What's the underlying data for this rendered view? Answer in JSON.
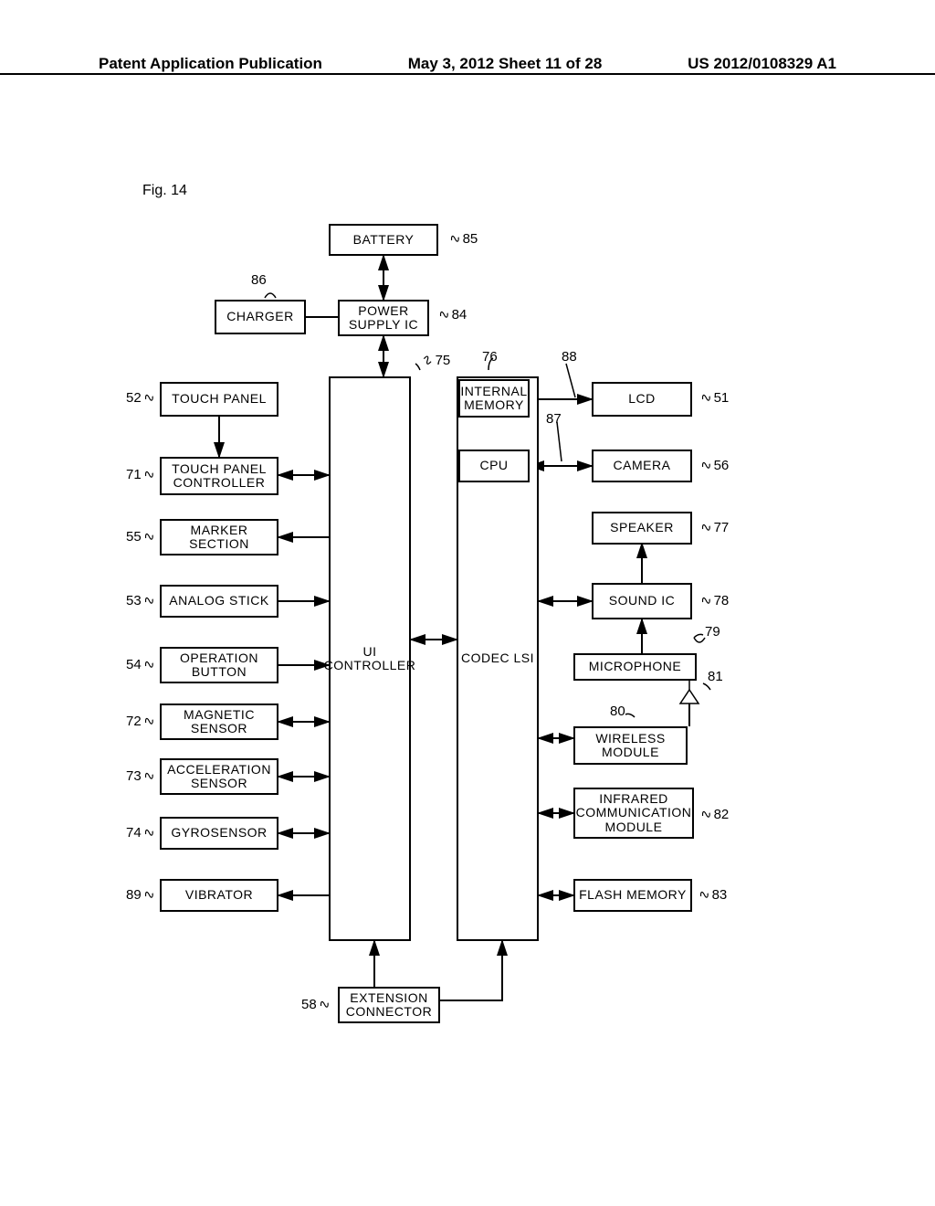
{
  "header": {
    "left": "Patent Application Publication",
    "center": "May 3, 2012  Sheet 11 of 28",
    "right": "US 2012/0108329 A1"
  },
  "figure_label": "Fig. 14",
  "blocks": {
    "battery": "BATTERY",
    "charger": "CHARGER",
    "power_supply": "POWER\nSUPPLY IC",
    "touch_panel": "TOUCH PANEL",
    "touch_panel_ctrl": "TOUCH PANEL\nCONTROLLER",
    "marker": "MARKER\nSECTION",
    "analog_stick": "ANALOG STICK",
    "operation_btn": "OPERATION\nBUTTON",
    "magnetic": "MAGNETIC\nSENSOR",
    "acceleration": "ACCELERATION\nSENSOR",
    "gyro": "GYROSENSOR",
    "vibrator": "VIBRATOR",
    "ui_controller": "UI\nCONTROLLER",
    "codec_lsi": "CODEC LSI",
    "internal_memory": "INTERNAL\nMEMORY",
    "cpu": "CPU",
    "lcd": "LCD",
    "camera": "CAMERA",
    "speaker": "SPEAKER",
    "sound_ic": "SOUND IC",
    "microphone": "MICROPHONE",
    "wireless": "WIRELESS\nMODULE",
    "infrared": "INFRARED\nCOMMUNICATION\nMODULE",
    "flash": "FLASH MEMORY",
    "extension": "EXTENSION\nCONNECTOR"
  },
  "refs": {
    "r85": "85",
    "r86": "86",
    "r84": "84",
    "r75": "75",
    "r76": "76",
    "r88": "88",
    "r87": "87",
    "r52": "52",
    "r71": "71",
    "r55": "55",
    "r53": "53",
    "r54": "54",
    "r72": "72",
    "r73": "73",
    "r74": "74",
    "r89": "89",
    "r51": "51",
    "r56": "56",
    "r77": "77",
    "r78": "78",
    "r79": "79",
    "r80": "80",
    "r81": "81",
    "r82": "82",
    "r83": "83",
    "r58": "58"
  }
}
